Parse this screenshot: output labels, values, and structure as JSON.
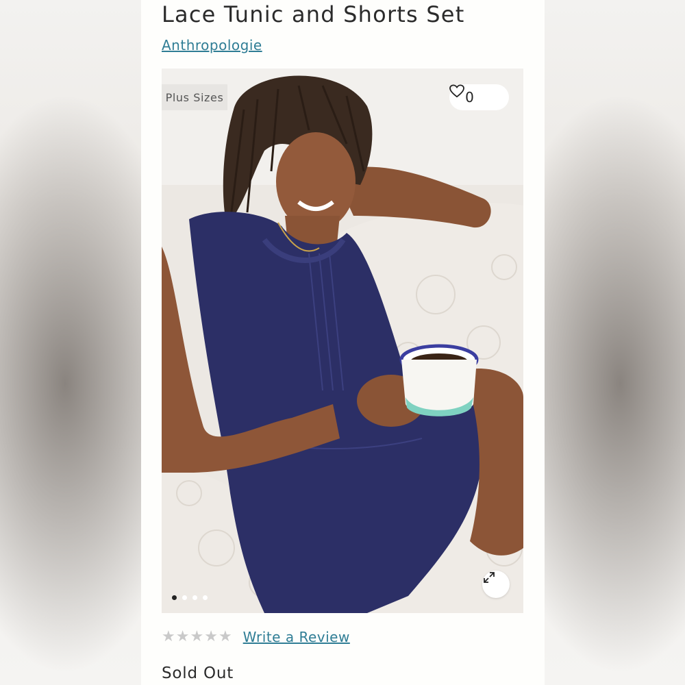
{
  "product": {
    "title": "Lace Tunic and Shorts Set",
    "brand": "Anthropologie",
    "badge": "Plus Sizes",
    "favorites_count": "0",
    "review_link": "Write a Review",
    "status": "Sold Out",
    "rating": {
      "stars_filled": 0,
      "stars_total": 5
    }
  },
  "gallery": {
    "image_count": 4,
    "active_index": 0
  },
  "icons": {
    "favorite": "heart-icon",
    "expand": "expand-icon",
    "star": "star-icon"
  },
  "colors": {
    "link": "#2f7d95",
    "text": "#2b2b2b",
    "badge_bg": "#e7e5e2",
    "garment": "#2c2f66"
  }
}
